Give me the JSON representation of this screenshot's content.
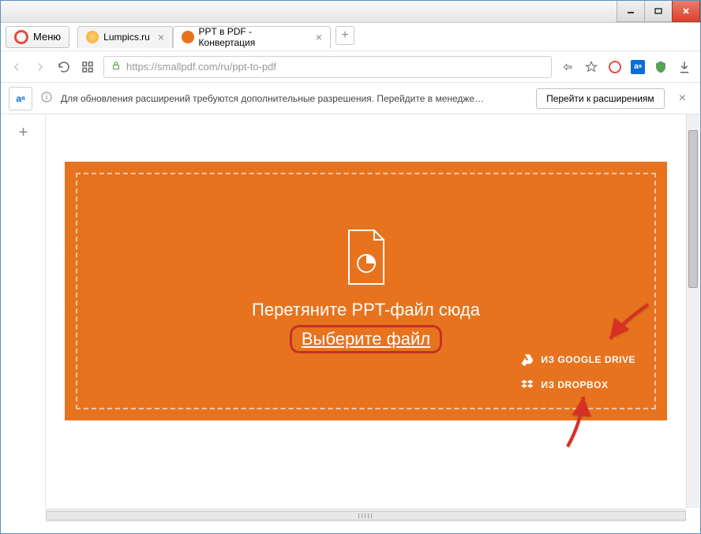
{
  "window": {
    "menu_label": "Меню"
  },
  "tabs": [
    {
      "title": "Lumpics.ru",
      "favicon_color": "#f7a428",
      "active": false
    },
    {
      "title": "PPT в PDF - Конвертация",
      "favicon_color": "#e8731e",
      "active": true
    }
  ],
  "addressbar": {
    "url_display": "https://smallpdf.com/ru/ppt-to-pdf"
  },
  "infobar": {
    "message": "Для обновления расширений требуются дополнительные разрешения. Перейдите в менедже…",
    "button": "Перейти к расширениям"
  },
  "dropzone": {
    "drag_text": "Перетяните PPT-файл сюда",
    "choose_file": "Выберите файл",
    "gdrive": "ИЗ GOOGLE DRIVE",
    "dropbox": "ИЗ DROPBOX"
  },
  "colors": {
    "accent": "#e8731e",
    "highlight_border": "#c43126"
  }
}
